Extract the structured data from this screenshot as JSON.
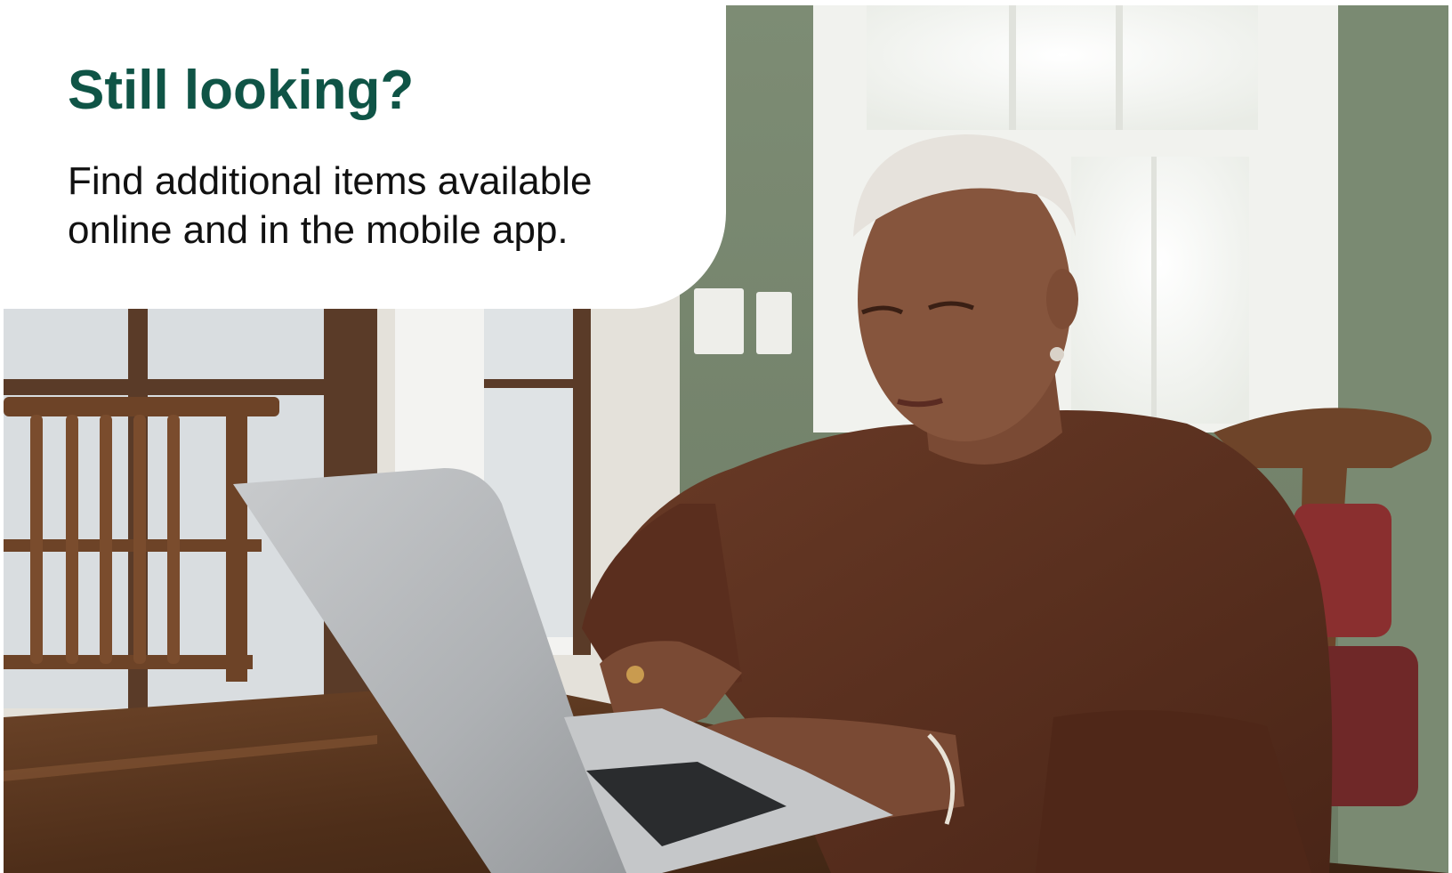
{
  "promo": {
    "headline": "Still looking?",
    "body": "Find additional items available online and in the mobile app."
  },
  "colors": {
    "headline": "#0f5446",
    "body": "#111111",
    "callout_background": "#ffffff"
  },
  "photo": {
    "subject": "photo-woman-using-laptop"
  }
}
